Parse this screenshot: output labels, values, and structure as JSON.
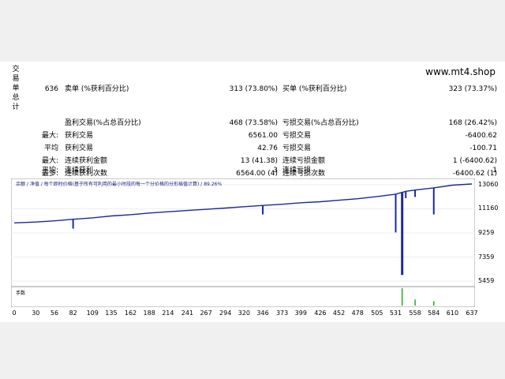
{
  "site": "www.mt4.shop",
  "side_label": [
    "交",
    "易",
    "单",
    "总",
    "计"
  ],
  "stats_rows": [
    {
      "c1": "636",
      "c2": "卖单 (%获利百分比)",
      "c3": "313 (73.80%)",
      "c4": "买单 (%获利百分比)",
      "c5": "323 (73.37%)"
    },
    {
      "c1": "",
      "c2": "盈利交易(%占总百分比)",
      "c3": "468 (73.58%)",
      "c4": "亏损交易(%占总百分比)",
      "c5": "168 (26.42%)"
    },
    {
      "c1": "最大:",
      "c2": "获利交易",
      "c3": "6561.00",
      "c4": "亏损交易",
      "c5": "-6400.62"
    },
    {
      "c1": "平均",
      "c2": "获利交易",
      "c3": "42.76",
      "c4": "亏损交易",
      "c5": "-100.71"
    },
    {
      "c1": "最大:",
      "c2": "连续获利金额",
      "c3": "13 (41.38)",
      "c4": "连续亏损金额",
      "c5": "1 (-6400.62)"
    },
    {
      "c1": "最多:",
      "c2": "连续获利次数",
      "c3": "6564.00 (4)",
      "c4": "连续亏损次数",
      "c5": "-6400.62 (1)"
    },
    {
      "c1": "平均:",
      "c2": "连续获利",
      "c3": "3",
      "c4": "连续亏损",
      "c5": "1"
    }
  ],
  "chart_caption": "余额 / 净值 / 每个即时价格(基于所有可利用的最小时段的每一个分价格的分形插值计算) / 89.26%",
  "lots_label": "手数",
  "chart_data": {
    "type": "line",
    "y_ticks": [
      "13060",
      "11160",
      "9259",
      "7359",
      "5459"
    ],
    "x_ticks": [
      "0",
      "30",
      "56",
      "82",
      "109",
      "135",
      "162",
      "188",
      "214",
      "241",
      "267",
      "294",
      "320",
      "346",
      "373",
      "399",
      "426",
      "452",
      "478",
      "505",
      "531",
      "558",
      "584",
      "610",
      "637"
    ],
    "ylim": [
      5459,
      13060
    ],
    "xlim": [
      0,
      637
    ],
    "balance_points": [
      [
        0,
        10050
      ],
      [
        30,
        10120
      ],
      [
        56,
        10210
      ],
      [
        82,
        10340
      ],
      [
        109,
        10450
      ],
      [
        135,
        10600
      ],
      [
        162,
        10700
      ],
      [
        188,
        10830
      ],
      [
        214,
        10930
      ],
      [
        241,
        11030
      ],
      [
        267,
        11120
      ],
      [
        294,
        11220
      ],
      [
        320,
        11330
      ],
      [
        346,
        11430
      ],
      [
        373,
        11520
      ],
      [
        399,
        11640
      ],
      [
        426,
        11720
      ],
      [
        452,
        11840
      ],
      [
        478,
        11960
      ],
      [
        505,
        12130
      ],
      [
        531,
        12320
      ],
      [
        545,
        12540
      ],
      [
        558,
        12640
      ],
      [
        584,
        12820
      ],
      [
        610,
        13030
      ],
      [
        637,
        13120
      ]
    ],
    "drawdowns": [
      [
        82,
        9600
      ],
      [
        346,
        10720
      ],
      [
        531,
        9300
      ],
      [
        540,
        5940
      ],
      [
        545,
        12000
      ],
      [
        558,
        12100
      ],
      [
        584,
        10720
      ]
    ],
    "lot_spikes": [
      [
        540,
        1.0
      ],
      [
        558,
        0.35
      ],
      [
        584,
        0.25
      ]
    ]
  }
}
